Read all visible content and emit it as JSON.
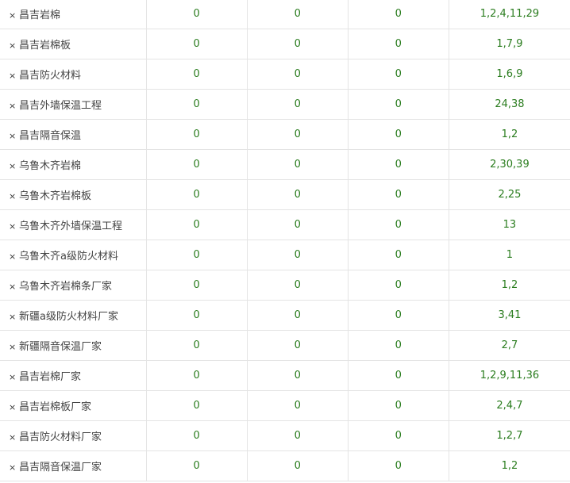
{
  "rows": [
    {
      "keyword": "昌吉岩棉",
      "c1": "0",
      "c2": "0",
      "c3": "0",
      "positions": "1,2,4,11,29"
    },
    {
      "keyword": "昌吉岩棉板",
      "c1": "0",
      "c2": "0",
      "c3": "0",
      "positions": "1,7,9"
    },
    {
      "keyword": "昌吉防火材料",
      "c1": "0",
      "c2": "0",
      "c3": "0",
      "positions": "1,6,9"
    },
    {
      "keyword": "昌吉外墙保温工程",
      "c1": "0",
      "c2": "0",
      "c3": "0",
      "positions": "24,38"
    },
    {
      "keyword": "昌吉隔音保温",
      "c1": "0",
      "c2": "0",
      "c3": "0",
      "positions": "1,2"
    },
    {
      "keyword": "乌鲁木齐岩棉",
      "c1": "0",
      "c2": "0",
      "c3": "0",
      "positions": "2,30,39"
    },
    {
      "keyword": "乌鲁木齐岩棉板",
      "c1": "0",
      "c2": "0",
      "c3": "0",
      "positions": "2,25"
    },
    {
      "keyword": "乌鲁木齐外墙保温工程",
      "c1": "0",
      "c2": "0",
      "c3": "0",
      "positions": "13"
    },
    {
      "keyword": "乌鲁木齐a级防火材料",
      "c1": "0",
      "c2": "0",
      "c3": "0",
      "positions": "1"
    },
    {
      "keyword": "乌鲁木齐岩棉条厂家",
      "c1": "0",
      "c2": "0",
      "c3": "0",
      "positions": "1,2"
    },
    {
      "keyword": "新疆a级防火材料厂家",
      "c1": "0",
      "c2": "0",
      "c3": "0",
      "positions": "3,41"
    },
    {
      "keyword": "新疆隔音保温厂家",
      "c1": "0",
      "c2": "0",
      "c3": "0",
      "positions": "2,7"
    },
    {
      "keyword": "昌吉岩棉厂家",
      "c1": "0",
      "c2": "0",
      "c3": "0",
      "positions": "1,2,9,11,36"
    },
    {
      "keyword": "昌吉岩棉板厂家",
      "c1": "0",
      "c2": "0",
      "c3": "0",
      "positions": "2,4,7"
    },
    {
      "keyword": "昌吉防火材料厂家",
      "c1": "0",
      "c2": "0",
      "c3": "0",
      "positions": "1,2,7"
    },
    {
      "keyword": "昌吉隔音保温厂家",
      "c1": "0",
      "c2": "0",
      "c3": "0",
      "positions": "1,2"
    }
  ],
  "icons": {
    "remove": "×"
  },
  "colors": {
    "value_green": "#2b7d1f",
    "text_gray": "#444444",
    "border": "#e4e4e4"
  }
}
